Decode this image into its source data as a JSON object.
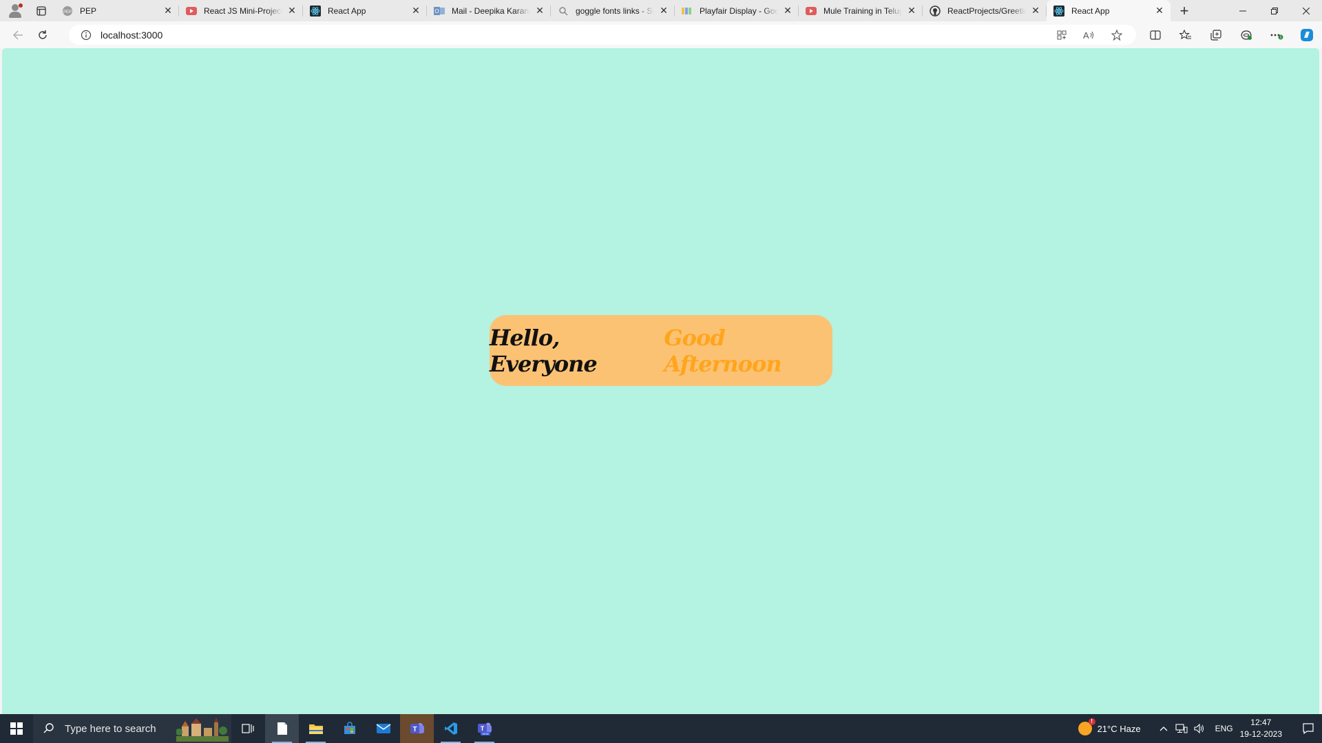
{
  "browser": {
    "tabs": [
      {
        "title": "PEP",
        "favicon": "pep-icon",
        "active": false
      },
      {
        "title": "React JS Mini-Projects",
        "favicon": "youtube-icon",
        "active": false
      },
      {
        "title": "React App",
        "favicon": "react-icon",
        "active": false
      },
      {
        "title": "Mail - Deepika Karanam",
        "favicon": "outlook-icon",
        "active": false
      },
      {
        "title": "goggle fonts links - Search",
        "favicon": "search-icon",
        "active": false
      },
      {
        "title": "Playfair Display - Google Fonts",
        "favicon": "google-fonts-icon",
        "active": false
      },
      {
        "title": "Mule Training in Telugu",
        "favicon": "youtube-icon",
        "active": false
      },
      {
        "title": "ReactProjects/Greeting",
        "favicon": "github-icon",
        "active": false
      },
      {
        "title": "React App",
        "favicon": "react-icon",
        "active": true
      }
    ],
    "url": "localhost:3000"
  },
  "page": {
    "greeting_hello": "Hello, Everyone",
    "greeting_time": "Good Afternoon",
    "colors": {
      "background": "#b4f2e1",
      "card": "#fbc274",
      "hello_text": "#111111",
      "time_text": "#ffa51c"
    }
  },
  "taskbar": {
    "search_placeholder": "Type here to search",
    "weather": "21°C  Haze",
    "language": "ENG",
    "time": "12:47",
    "date": "19-12-2023"
  }
}
